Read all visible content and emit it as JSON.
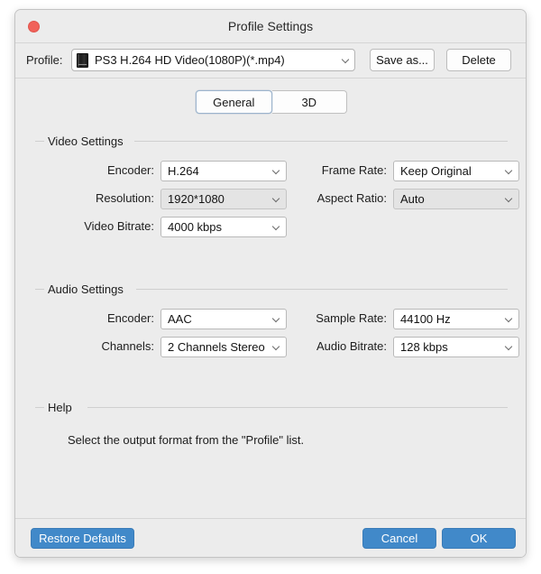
{
  "window": {
    "title": "Profile Settings",
    "close_icon": "close-icon",
    "accent_blue": "#4189c9",
    "close_red": "#f1625a",
    "background": "#ececec"
  },
  "profile_bar": {
    "label": "Profile:",
    "icon": "ps3-console-icon",
    "value": "PS3 H.264 HD Video(1080P)(*.mp4)",
    "chevron_icon": "chevron-down-icon",
    "save_as_label": "Save as...",
    "delete_label": "Delete"
  },
  "tabs": [
    {
      "label": "General",
      "active": true
    },
    {
      "label": "3D",
      "active": false
    }
  ],
  "video_settings": {
    "legend": "Video Settings",
    "fields": [
      {
        "label": "Encoder:",
        "value": "H.264",
        "dimmed": false
      },
      {
        "label": "Resolution:",
        "value": "1920*1080",
        "dimmed": true
      },
      {
        "label": "Video Bitrate:",
        "value": "4000 kbps",
        "dimmed": false
      },
      {
        "label": "Frame Rate:",
        "value": "Keep Original",
        "dimmed": false
      },
      {
        "label": "Aspect Ratio:",
        "value": "Auto",
        "dimmed": true
      }
    ]
  },
  "audio_settings": {
    "legend": "Audio Settings",
    "fields": [
      {
        "label": "Encoder:",
        "value": "AAC",
        "dimmed": false
      },
      {
        "label": "Channels:",
        "value": "2 Channels Stereo",
        "dimmed": false
      },
      {
        "label": "Sample Rate:",
        "value": "44100 Hz",
        "dimmed": false
      },
      {
        "label": "Audio Bitrate:",
        "value": "128 kbps",
        "dimmed": false
      }
    ]
  },
  "help": {
    "legend": "Help",
    "text": "Select the output format from the \"Profile\" list."
  },
  "footer": {
    "restore_label": "Restore Defaults",
    "cancel_label": "Cancel",
    "ok_label": "OK"
  }
}
